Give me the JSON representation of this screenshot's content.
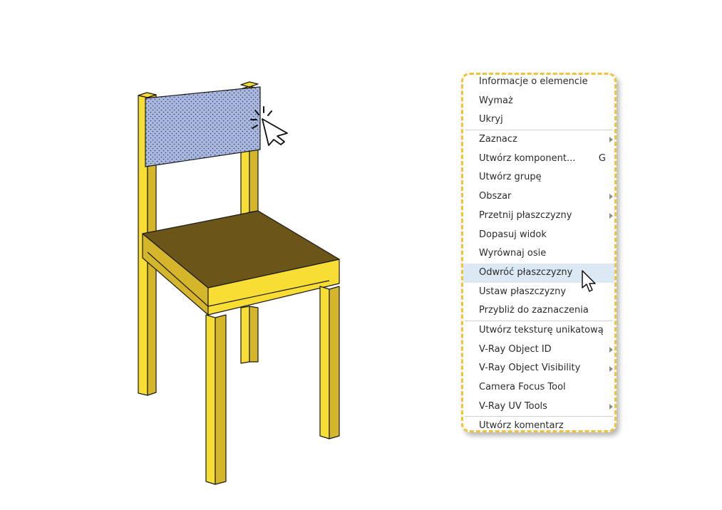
{
  "scene": {
    "colors": {
      "frame": "#f7dd34",
      "frame_shade": "#d5b52a",
      "seat_top": "#6b5518",
      "backrest": "#a9b8dc",
      "backrest_dots": "#2f3f78",
      "outline": "#1a1a1a"
    }
  },
  "context_menu": {
    "border_color": "#f2c23a",
    "highlight_color": "#dce9f5",
    "items": [
      {
        "label": "Informacje o elemencie",
        "shortcut": "",
        "submenu": false
      },
      {
        "label": "Wymaż",
        "shortcut": "",
        "submenu": false
      },
      {
        "label": "Ukryj",
        "shortcut": "",
        "submenu": false
      },
      {
        "label": "Zaznacz",
        "shortcut": "",
        "submenu": true
      },
      {
        "label": "Utwórz komponent...",
        "shortcut": "G",
        "submenu": false
      },
      {
        "label": "Utwórz grupę",
        "shortcut": "",
        "submenu": false
      },
      {
        "label": "Obszar",
        "shortcut": "",
        "submenu": true
      },
      {
        "label": "Przetnij płaszczyzny",
        "shortcut": "",
        "submenu": true
      },
      {
        "label": "Dopasuj widok",
        "shortcut": "",
        "submenu": false
      },
      {
        "label": "Wyrównaj osie",
        "shortcut": "",
        "submenu": false
      },
      {
        "label": "Odwróć płaszczyzny",
        "shortcut": "",
        "submenu": false
      },
      {
        "label": "Ustaw płaszczyzny",
        "shortcut": "",
        "submenu": false
      },
      {
        "label": "Przybliż do zaznaczenia",
        "shortcut": "",
        "submenu": false
      },
      {
        "label": "Utwórz teksturę unikatową",
        "shortcut": "",
        "submenu": false
      },
      {
        "label": "V-Ray Object ID",
        "shortcut": "",
        "submenu": true
      },
      {
        "label": "V-Ray Object Visibility",
        "shortcut": "",
        "submenu": true
      },
      {
        "label": "Camera Focus Tool",
        "shortcut": "",
        "submenu": false
      },
      {
        "label": "V-Ray UV Tools",
        "shortcut": "",
        "submenu": true
      },
      {
        "label": "Utwórz komentarz",
        "shortcut": "",
        "submenu": false
      }
    ],
    "highlighted_label": "Odwróć płaszczyzny",
    "separators_after": [
      "Ukryj",
      "Przybliż do zaznaczenia",
      "V-Ray UV Tools"
    ]
  },
  "icons": {
    "click_cursor": "arrow-cursor-click-icon",
    "menu_cursor": "arrow-cursor-icon",
    "submenu": "submenu-arrow-icon"
  }
}
